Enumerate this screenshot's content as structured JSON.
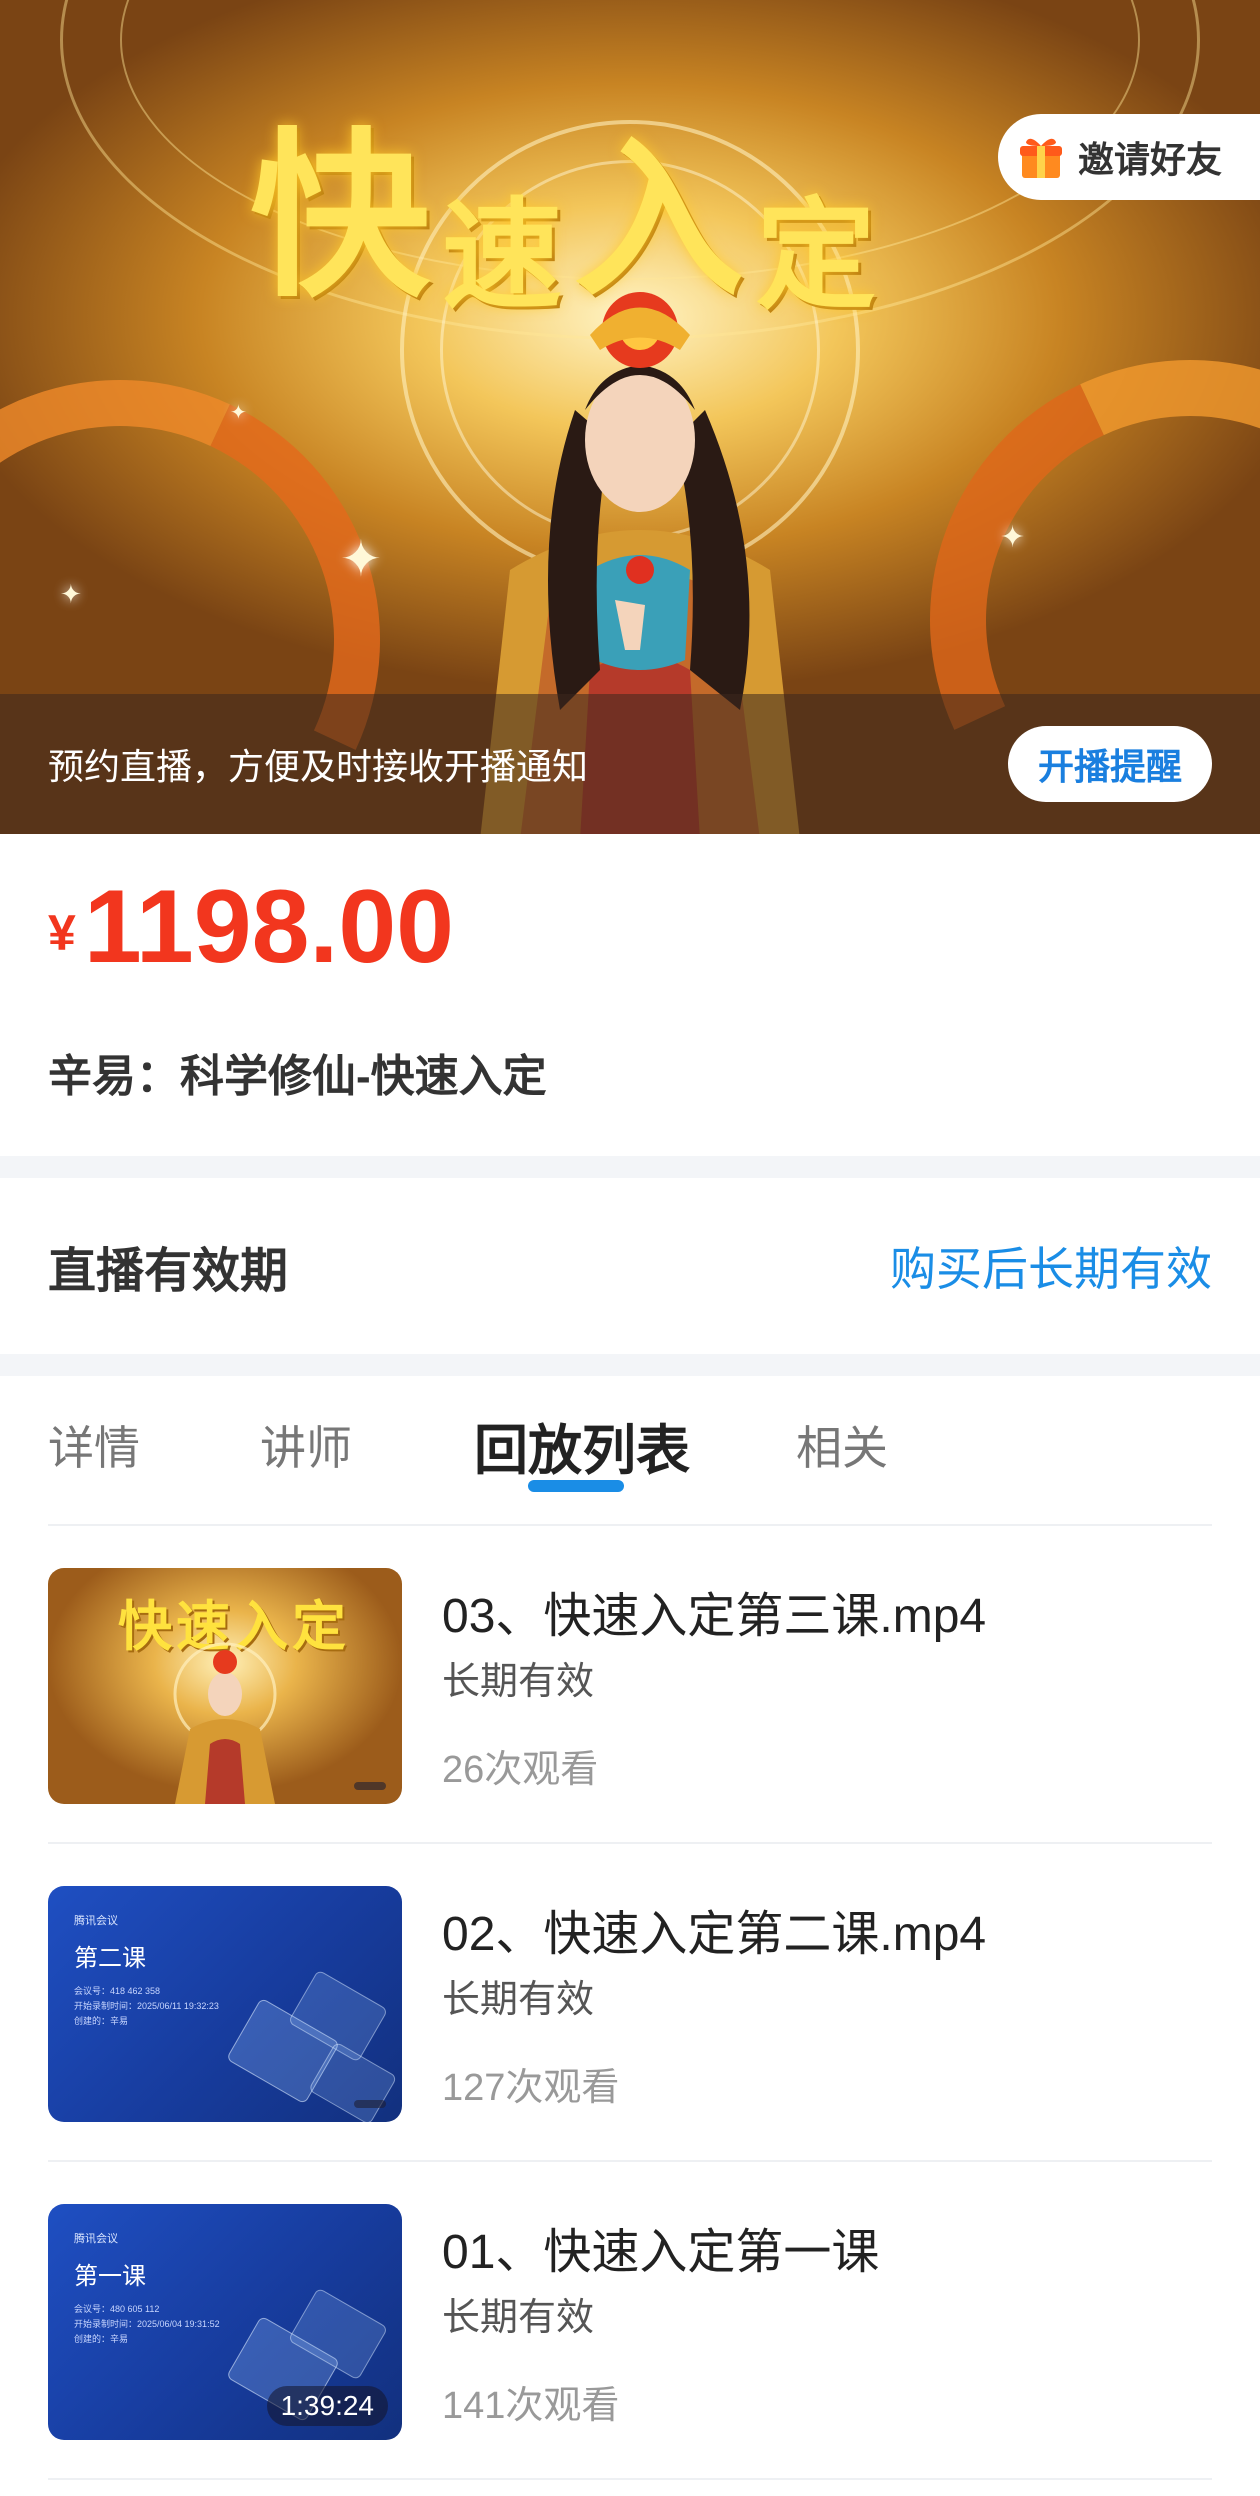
{
  "hero": {
    "title_chars": [
      "快",
      "速",
      "入",
      "定"
    ],
    "invite_label": "邀请好友",
    "invite_icon": "gift-icon",
    "notice_text": "预约直播，方便及时接收开播通知",
    "remind_button": "开播提醒"
  },
  "product": {
    "currency": "¥",
    "price": "1198.00",
    "title": "辛易：科学修仙-快速入定"
  },
  "validity": {
    "label": "直播有效期",
    "value": "购买后长期有效"
  },
  "tabs": [
    "详情",
    "讲师",
    "回放列表",
    "相关"
  ],
  "active_tab": "回放列表",
  "playlist": [
    {
      "title": "03、快速入定第三课.mp4",
      "validity": "长期有效",
      "views": "26次观看",
      "thumb_style": "gold",
      "thumb_title": "快速入定"
    },
    {
      "title": "02、快速入定第二课.mp4",
      "validity": "长期有效",
      "views": "127次观看",
      "thumb_style": "blue",
      "thumb_logo": "腾讯会议",
      "thumb_lesson": "第二课",
      "thumb_meta": [
        "会议号：418 462 358",
        "开始录制时间：2025/06/11 19:32:23",
        "创建的：辛易"
      ]
    },
    {
      "title": "01、快速入定第一课",
      "validity": "长期有效",
      "views": "141次观看",
      "thumb_style": "blue",
      "thumb_logo": "腾讯会议",
      "thumb_lesson": "第一课",
      "thumb_meta": [
        "会议号：480 605 112",
        "开始录制时间：2025/06/04 19:31:52",
        "创建的：辛易"
      ],
      "duration": "1:39:24"
    }
  ],
  "colors": {
    "price": "#f2361e",
    "accent": "#1a8de6",
    "remind_text": "#1a7fdf"
  }
}
